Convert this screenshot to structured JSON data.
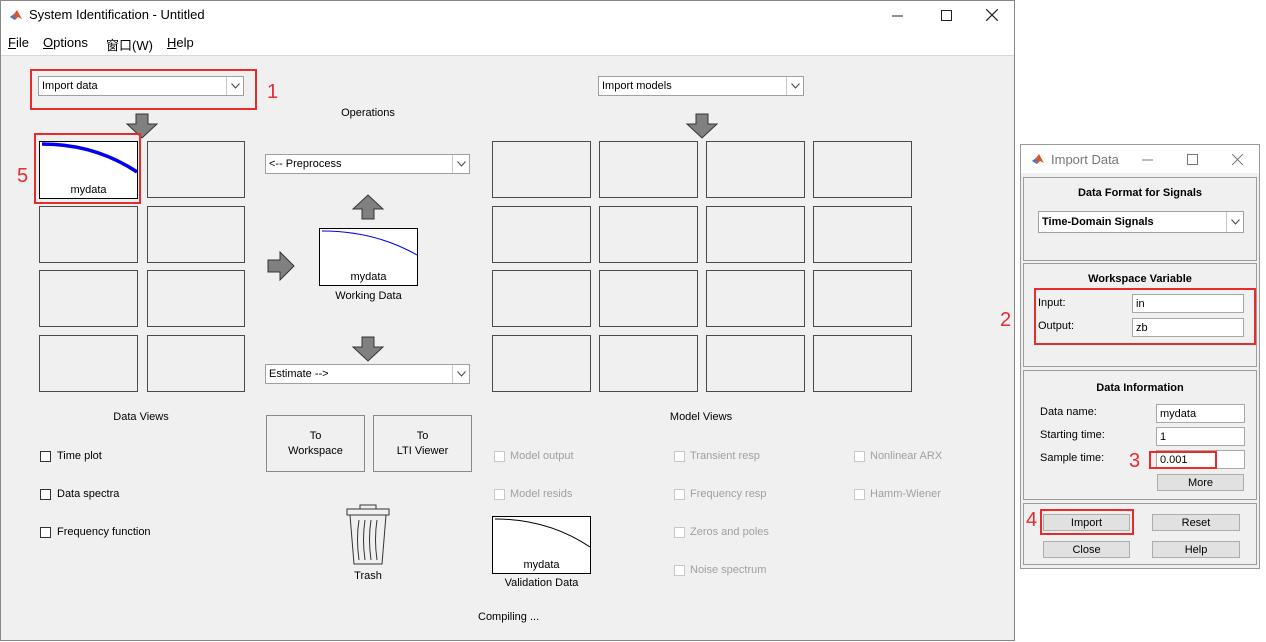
{
  "window": {
    "title": "System Identification - Untitled",
    "controls": [
      "minimize-icon",
      "maximize-icon",
      "close-icon"
    ]
  },
  "menu": [
    {
      "label": "File",
      "mnemonic": "F"
    },
    {
      "label": "Options",
      "mnemonic": "O"
    },
    {
      "label": "窗口(W)"
    },
    {
      "label": "Help",
      "mnemonic": "H"
    }
  ],
  "import_data_select": "Import data",
  "import_models_select": "Import models",
  "operations_label": "Operations",
  "preprocess_select": "<-- Preprocess",
  "estimate_select": "Estimate -->",
  "working_data": {
    "name": "mydata",
    "caption": "Working Data"
  },
  "data_board": {
    "first_item": "mydata"
  },
  "data_views": {
    "title": "Data Views",
    "checkboxes": [
      "Time plot",
      "Data spectra",
      "Frequency function"
    ]
  },
  "buttons": {
    "to_workspace": [
      "To",
      "Workspace"
    ],
    "to_lti": [
      "To",
      "LTI Viewer"
    ]
  },
  "trash_label": "Trash",
  "validation_data": {
    "name": "mydata",
    "caption": "Validation Data"
  },
  "model_views": {
    "title": "Model Views",
    "col1": [
      "Model output",
      "Model resids"
    ],
    "col2": [
      "Transient resp",
      "Frequency resp",
      "Zeros and poles",
      "Noise spectrum"
    ],
    "col3": [
      "Nonlinear ARX",
      "Hamm-Wiener"
    ]
  },
  "status": "Compiling ...",
  "annotations": [
    "1",
    "2",
    "3",
    "4",
    "5"
  ],
  "colors": {
    "annotation_red": "#e82b2b",
    "plot_blue": "#0000ee"
  },
  "dialog": {
    "title": "Import Data",
    "format_panel": {
      "title": "Data Format for Signals",
      "value": "Time-Domain Signals"
    },
    "workspace_panel": {
      "title": "Workspace Variable",
      "input_label": "Input:",
      "input_value": "in",
      "output_label": "Output:",
      "output_value": "zb"
    },
    "info_panel": {
      "title": "Data Information",
      "name_label": "Data name:",
      "name_value": "mydata",
      "start_label": "Starting time:",
      "start_value": "1",
      "sample_label": "Sample time:",
      "sample_value": "0.001",
      "more": "More"
    },
    "import": "Import",
    "reset": "Reset",
    "close": "Close",
    "help": "Help"
  }
}
